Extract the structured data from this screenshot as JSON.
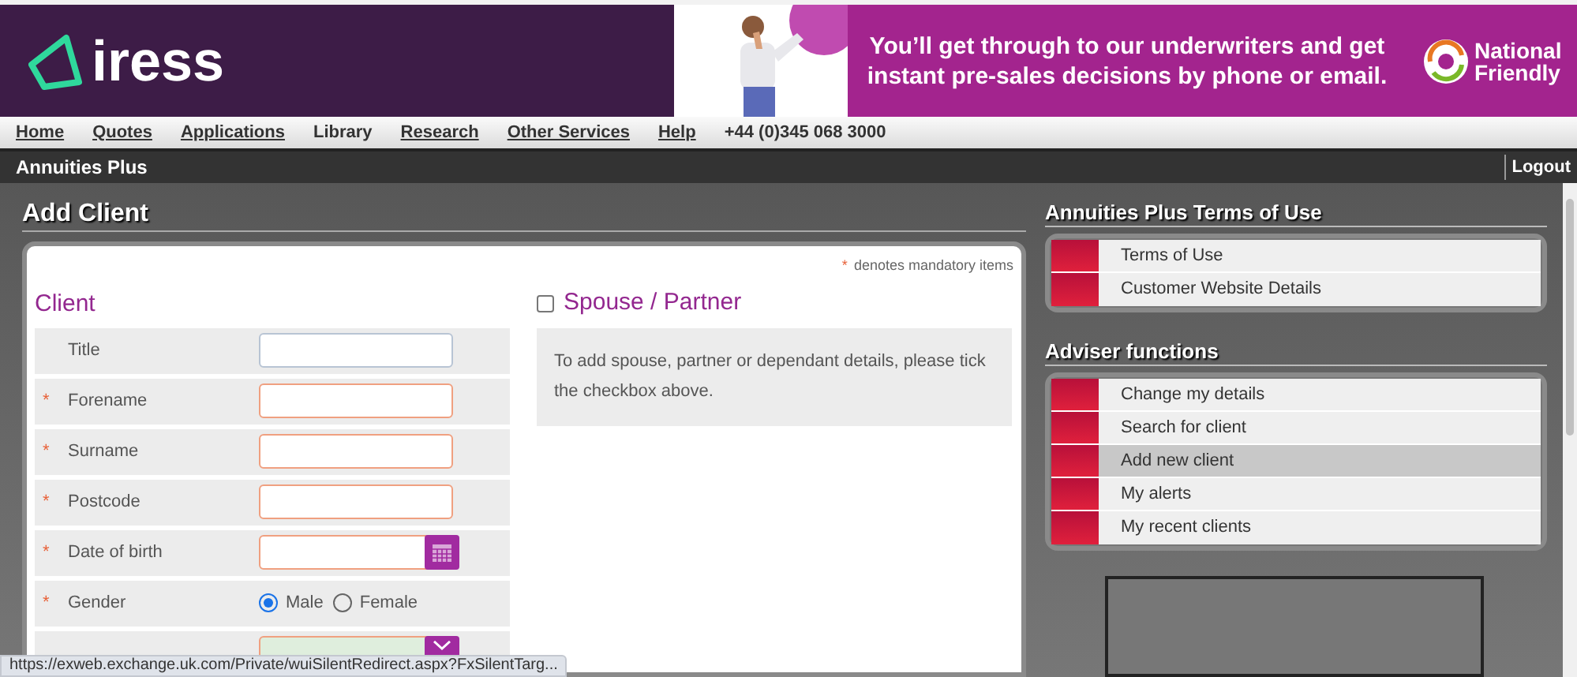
{
  "header": {
    "logo": "iress",
    "banner": {
      "text": "You’ll get through to our underwriters and get instant pre-sales decisions by phone or email.",
      "brand": "National Friendly"
    }
  },
  "nav": [
    {
      "label": "Home",
      "kind": "link"
    },
    {
      "label": "Quotes",
      "kind": "link"
    },
    {
      "label": "Applications",
      "kind": "link"
    },
    {
      "label": "Library",
      "kind": "plain"
    },
    {
      "label": "Research",
      "kind": "link"
    },
    {
      "label": "Other Services",
      "kind": "link"
    },
    {
      "label": "Help",
      "kind": "link"
    },
    {
      "label": "+44 (0)345 068 3000",
      "kind": "plain"
    }
  ],
  "app_bar": {
    "title": "Annuities Plus",
    "logout": "Logout"
  },
  "page_title": "Add Client",
  "mandatory_note": {
    "mark": "*",
    "text": "denotes mandatory items"
  },
  "client": {
    "heading": "Client",
    "rows": [
      {
        "kind": "text",
        "label": "Title",
        "required": false
      },
      {
        "kind": "text",
        "label": "Forename",
        "required": true
      },
      {
        "kind": "text",
        "label": "Surname",
        "required": true
      },
      {
        "kind": "text",
        "label": "Postcode",
        "required": true
      },
      {
        "kind": "date",
        "label": "Date of birth",
        "required": true
      },
      {
        "kind": "radio",
        "label": "Gender",
        "required": true,
        "options": [
          {
            "label": "Male",
            "selected": true
          },
          {
            "label": "Female",
            "selected": false
          }
        ]
      },
      {
        "kind": "select",
        "required": false
      }
    ]
  },
  "spouse": {
    "heading": "Spouse / Partner",
    "checked": false,
    "note": "To add spouse, partner or dependant details, please tick the checkbox above."
  },
  "sidebar": [
    {
      "heading": "Annuities Plus Terms of Use",
      "items": [
        {
          "label": "Terms of Use",
          "selected": false
        },
        {
          "label": "Customer Website Details",
          "selected": false
        }
      ]
    },
    {
      "heading": "Adviser functions",
      "items": [
        {
          "label": "Change my details",
          "selected": false
        },
        {
          "label": "Search for client",
          "selected": false
        },
        {
          "label": "Add new client",
          "selected": true
        },
        {
          "label": "My alerts",
          "selected": false
        },
        {
          "label": "My recent clients",
          "selected": false
        }
      ]
    }
  ],
  "status_bar": "https://exweb.exchange.uk.com/Private/wuiSilentRedirect.aspx?FxSilentTarg..."
}
